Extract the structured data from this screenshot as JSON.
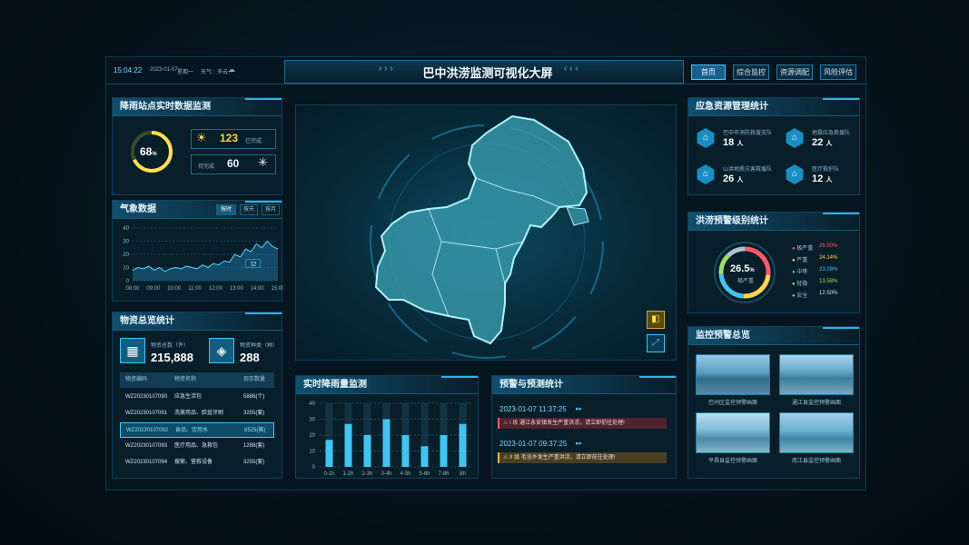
{
  "header": {
    "time": "15:04:22",
    "date": "2023-01-07",
    "weekday": "星期一",
    "weather": "天气：多云",
    "title": "巴中洪涝监测可视化大屏",
    "nav": [
      "首页",
      "综合监控",
      "资源调配",
      "风险评估"
    ]
  },
  "rain_station": {
    "title": "降雨站点实时数据监测",
    "percent": "68",
    "percent_unit": "%",
    "done_value": "123",
    "done_label": "已完成",
    "pending_label": "待完成",
    "pending_value": "60"
  },
  "weather": {
    "title": "气象数据",
    "tabs": [
      "按时",
      "按天",
      "按月"
    ],
    "tooltip": "12",
    "chart_data": {
      "type": "area",
      "x": [
        "08:00",
        "09:00",
        "10:00",
        "11:00",
        "12:00",
        "13:00",
        "14:00",
        "15:00"
      ],
      "values": [
        8,
        10,
        9,
        11,
        8,
        10,
        7,
        9,
        10,
        9,
        11,
        10,
        9,
        12,
        10,
        13,
        12,
        15,
        14,
        20,
        18,
        24,
        22,
        28,
        25,
        30,
        26,
        24
      ],
      "ylim": [
        0,
        40
      ],
      "yticks": [
        "40",
        "30",
        "20",
        "10",
        "0"
      ],
      "colors": {
        "line": "#5fd4ff",
        "fill": "#1d6f9a"
      }
    }
  },
  "supplies": {
    "title": "物资总览统计",
    "total_label": "物资总数（件）",
    "total_value": "215,888",
    "kinds_label": "物资种类（种）",
    "kinds_value": "288",
    "columns": [
      "物资编码",
      "物资名称",
      "现存数量"
    ],
    "rows": [
      [
        "WZ20230107090",
        "应急生活包",
        "5888(个)"
      ],
      [
        "WZ20230107091",
        "洗漱用品、脸盆牙刷",
        "3255(套)"
      ],
      [
        "WZ20230107092",
        "食品、饮用水",
        "8525(箱)"
      ],
      [
        "WZ20230107093",
        "医疗用品、急救包",
        "1288(套)"
      ],
      [
        "WZ20230107094",
        "搜索、营救设备",
        "3255(套)"
      ]
    ]
  },
  "rainfall": {
    "title": "实时降雨量监测",
    "chart_data": {
      "type": "bar",
      "categories": [
        "0-1h",
        "1-2h",
        "2-3h",
        "3-4h",
        "4-5h",
        "5-6h",
        "7-8h",
        "8h"
      ],
      "values": [
        17,
        27,
        20,
        30,
        20,
        13,
        20,
        27
      ],
      "ylim": [
        0,
        40
      ],
      "yticks": [
        "40",
        "30",
        "20",
        "10",
        "0"
      ],
      "colors": {
        "bar": "#3ec6f3"
      }
    }
  },
  "warnings": {
    "title": "预警与预测统计",
    "items": [
      {
        "time": "2023-01-07 11:37:25",
        "level": "I 级",
        "text": "通江永安镇发生严重洪涝，请立即前往处理!"
      },
      {
        "time": "2023-01-07 09:37:25",
        "level": "II 级",
        "text": "毛浴乡发生严重洪涝，请立即前往处理!"
      }
    ]
  },
  "resources": {
    "title": "应急资源管理统计",
    "items": [
      {
        "name": "巴中市消防救援支队",
        "value": "18",
        "unit": "人"
      },
      {
        "name": "地震应急救援队",
        "value": "22",
        "unit": "人"
      },
      {
        "name": "山洪地质灾害救援队",
        "value": "26",
        "unit": "人"
      },
      {
        "name": "医疗救护队",
        "value": "12",
        "unit": "人"
      }
    ]
  },
  "flood_level": {
    "title": "洪涝预警级别统计",
    "center_value": "26.5",
    "center_unit": "%",
    "center_label": "极严重",
    "levels": [
      {
        "name": "极严重",
        "value": "26.50%",
        "color": "#ff5a6a"
      },
      {
        "name": "严重",
        "value": "24.14%",
        "color": "#ffd54a"
      },
      {
        "name": "中等",
        "value": "23.28%",
        "color": "#3ec6f3"
      },
      {
        "name": "轻微",
        "value": "13.58%",
        "color": "#9be15d"
      },
      {
        "name": "安全",
        "value": "12.50%",
        "color": "#a9c3d0"
      }
    ]
  },
  "monitor": {
    "title": "监控预警总览",
    "cams": [
      "巴州区监控预警画面",
      "通江县监控预警画面",
      "平昌县监控预警画面",
      "南江县监控预警画面"
    ]
  }
}
